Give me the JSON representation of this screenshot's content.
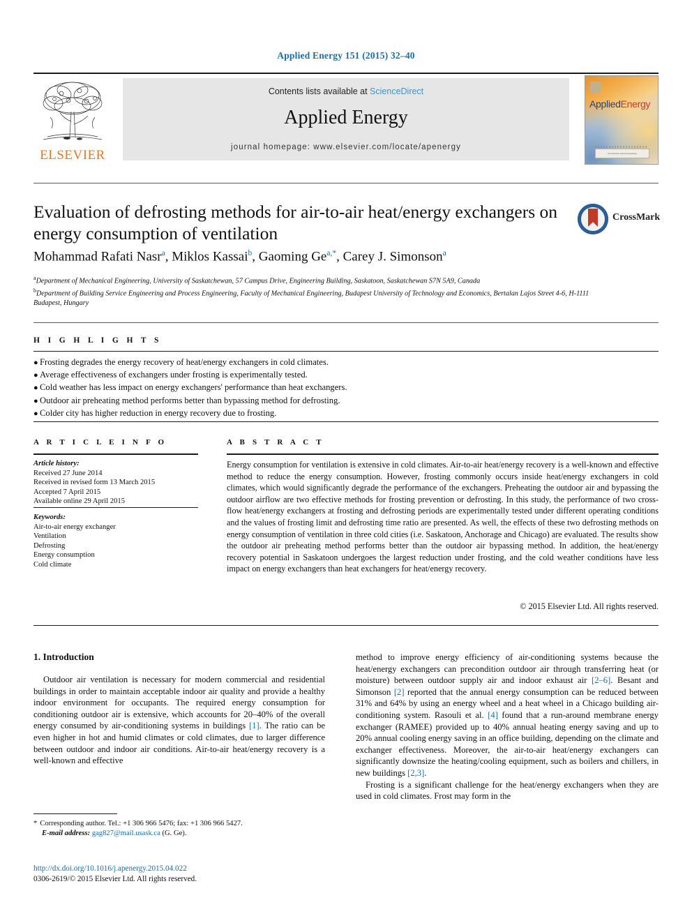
{
  "running_head": "Applied Energy 151 (2015) 32–40",
  "masthead": {
    "publisher_name": "ELSEVIER",
    "contents_prefix": "Contents lists available at ",
    "contents_link": "ScienceDirect",
    "journal_title": "Applied Energy",
    "homepage": "journal homepage: www.elsevier.com/locate/apenergy",
    "cover": {
      "title_part1": "Applied",
      "title_part2": "Energy",
      "footer_text": "www.elsevier.com/locate/apenergy"
    }
  },
  "article": {
    "title": "Evaluation of defrosting methods for air-to-air heat/energy exchangers on energy consumption of ventilation",
    "crossmark_label": "CrossMark",
    "authors": [
      {
        "name": "Mohammad Rafati Nasr",
        "marks": "a",
        "sep": ", "
      },
      {
        "name": "Miklos Kassai",
        "marks": "b",
        "sep": ", "
      },
      {
        "name": "Gaoming Ge",
        "marks": "a,*",
        "sep": ", "
      },
      {
        "name": "Carey J. Simonson",
        "marks": "a",
        "sep": ""
      }
    ],
    "affiliations": [
      {
        "mark": "a",
        "text": "Department of Mechanical Engineering, University of Saskatchewan, 57 Campus Drive, Engineering Building, Saskatoon, Saskatchewan S7N 5A9, Canada"
      },
      {
        "mark": "b",
        "text": "Department of Building Service Engineering and Process Engineering, Faculty of Mechanical Engineering, Budapest University of Technology and Economics, Bertalan Lajos Street 4-6, H-1111 Budapest, Hungary"
      }
    ]
  },
  "highlights": {
    "heading": "H I G H L I G H T S",
    "items": [
      "Frosting degrades the energy recovery of heat/energy exchangers in cold climates.",
      "Average effectiveness of exchangers under frosting is experimentally tested.",
      "Cold weather has less impact on energy exchangers' performance than heat exchangers.",
      "Outdoor air preheating method performs better than bypassing method for defrosting.",
      "Colder city has higher reduction in energy recovery due to frosting."
    ]
  },
  "article_info": {
    "heading": "A R T I C L E   I N F O",
    "history_label": "Article history:",
    "history": [
      "Received 27 June 2014",
      "Received in revised form 13 March 2015",
      "Accepted 7 April 2015",
      "Available online 29 April 2015"
    ],
    "keywords_label": "Keywords:",
    "keywords": [
      "Air-to-air energy exchanger",
      "Ventilation",
      "Defrosting",
      "Energy consumption",
      "Cold climate"
    ]
  },
  "abstract": {
    "heading": "A B S T R A C T",
    "text": "Energy consumption for ventilation is extensive in cold climates. Air-to-air heat/energy recovery is a well-known and effective method to reduce the energy consumption. However, frosting commonly occurs inside heat/energy exchangers in cold climates, which would significantly degrade the performance of the exchangers. Preheating the outdoor air and bypassing the outdoor airflow are two effective methods for frosting prevention or defrosting. In this study, the performance of two cross-flow heat/energy exchangers at frosting and defrosting periods are experimentally tested under different operating conditions and the values of frosting limit and defrosting time ratio are presented. As well, the effects of these two defrosting methods on energy consumption of ventilation in three cold cities (i.e. Saskatoon, Anchorage and Chicago) are evaluated. The results show the outdoor air preheating method performs better than the outdoor air bypassing method. In addition, the heat/energy recovery potential in Saskatoon undergoes the largest reduction under frosting, and the cold weather conditions have less impact on energy exchangers than heat exchangers for heat/energy recovery.",
    "copyright": "© 2015 Elsevier Ltd. All rights reserved."
  },
  "body": {
    "section_title": "1. Introduction",
    "left_paragraph": "Outdoor air ventilation is necessary for modern commercial and residential buildings in order to maintain acceptable indoor air quality and provide a healthy indoor environment for occupants. The required energy consumption for conditioning outdoor air is extensive, which accounts for 20–40% of the overall energy consumed by air-conditioning systems in buildings [1]. The ratio can be even higher in hot and humid climates or cold climates, due to larger difference between outdoor and indoor air conditions. Air-to-air heat/energy recovery is a well-known and effective",
    "right_paragraph_1": "method to improve energy efficiency of air-conditioning systems because the heat/energy exchangers can precondition outdoor air through transferring heat (or moisture) between outdoor supply air and indoor exhaust air [2–6]. Besant and Simonson [2] reported that the annual energy consumption can be reduced between 31% and 64% by using an energy wheel and a heat wheel in a Chicago building air-conditioning system. Rasouli et al. [4] found that a run-around membrane energy exchanger (RAMEE) provided up to 40% annual heating energy saving and up to 20% annual cooling energy saving in an office building, depending on the climate and exchanger effectiveness. Moreover, the air-to-air heat/energy exchangers can significantly downsize the heating/cooling equipment, such as boilers and chillers, in new buildings [2,3].",
    "right_paragraph_2": "Frosting is a significant challenge for the heat/energy exchangers when they are used in cold climates. Frost may form in the"
  },
  "footnote": {
    "corresponding": "Corresponding author. Tel.: +1 306 966 5476; fax: +1 306 966 5427.",
    "email_label": "E-mail address:",
    "email": "gag827@mail.usask.ca",
    "email_suffix": "(G. Ge)."
  },
  "doi": {
    "url": "http://dx.doi.org/10.1016/j.apenergy.2015.04.022",
    "issn_line": "0306-2619/© 2015 Elsevier Ltd. All rights reserved."
  },
  "colors": {
    "link_blue": "#1c6ea4",
    "sciencedirect_blue": "#3f93c7",
    "elsevier_orange": "#e87722"
  }
}
